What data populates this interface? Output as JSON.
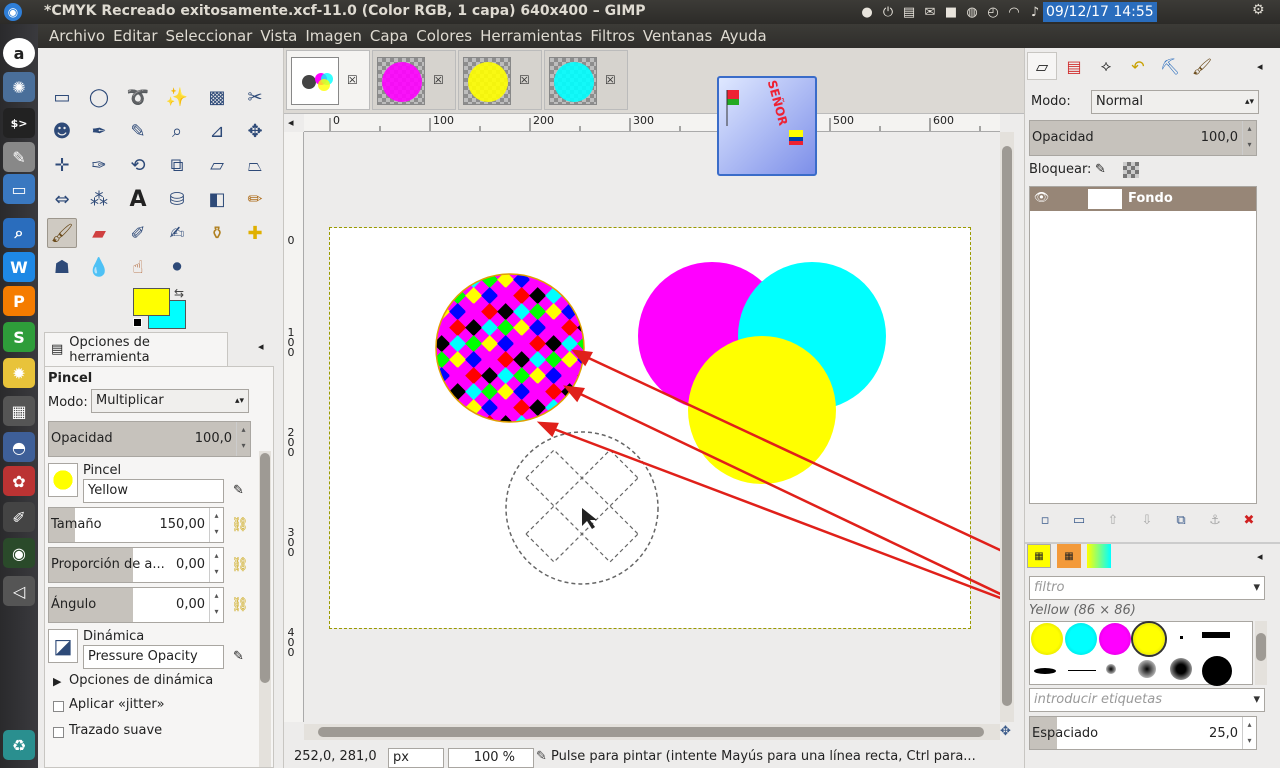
{
  "window": {
    "title": "*CMYK Recreado exitosamente.xcf-11.0 (Color RGB, 1 capa) 640x400 – GIMP",
    "clock": "09/12/17 14:55"
  },
  "menubar": {
    "items": [
      "Archivo",
      "Editar",
      "Seleccionar",
      "Vista",
      "Imagen",
      "Capa",
      "Colores",
      "Herramientas",
      "Filtros",
      "Ventanas",
      "Ayuda"
    ]
  },
  "launcher": {
    "items": [
      "a",
      "S",
      "W",
      "P",
      "S"
    ]
  },
  "tool_options": {
    "tab_label": "Opciones de herramienta",
    "tool_name": "Pincel",
    "mode_label": "Modo:",
    "mode_value": "Multiplicar",
    "opacity_label": "Opacidad",
    "opacity_value": "100,0",
    "brush_label": "Pincel",
    "brush_value": "Yellow",
    "size_label": "Tamaño",
    "size_value": "150,00",
    "ratio_label": "Proporción de a...",
    "ratio_value": "0,00",
    "angle_label": "Ángulo",
    "angle_value": "0,00",
    "dynamics_label": "Dinámica",
    "dynamics_value": "Pressure Opacity",
    "dynamics_options": "Opciones de dinámica",
    "jitter_label": "Aplicar «jitter»",
    "smooth_label": "Trazado suave"
  },
  "ruler": {
    "h": [
      "0",
      "100",
      "200",
      "300",
      "400",
      "500",
      "600"
    ],
    "v": [
      "100",
      "200",
      "300",
      "400"
    ]
  },
  "status": {
    "coords": "252,0, 281,0",
    "unit": "px",
    "zoom": "100 %",
    "message": "Pulse para pintar (intente Mayús para una línea recta, Ctrl para..."
  },
  "layers": {
    "mode_label": "Modo:",
    "mode_value": "Normal",
    "opacity_label": "Opacidad",
    "opacity_value": "100,0",
    "lock_label": "Bloquear:",
    "layer_name": "Fondo"
  },
  "brushes": {
    "filter_placeholder": "filtro",
    "selected_caption": "Yellow (86 × 86)",
    "tags_placeholder": "introducir etiquetas",
    "spacing_label": "Espaciado",
    "spacing_value": "25,0"
  },
  "colors": {
    "fg": "#ffff00",
    "bg": "#00ffff",
    "annotation": "#e0201a"
  }
}
